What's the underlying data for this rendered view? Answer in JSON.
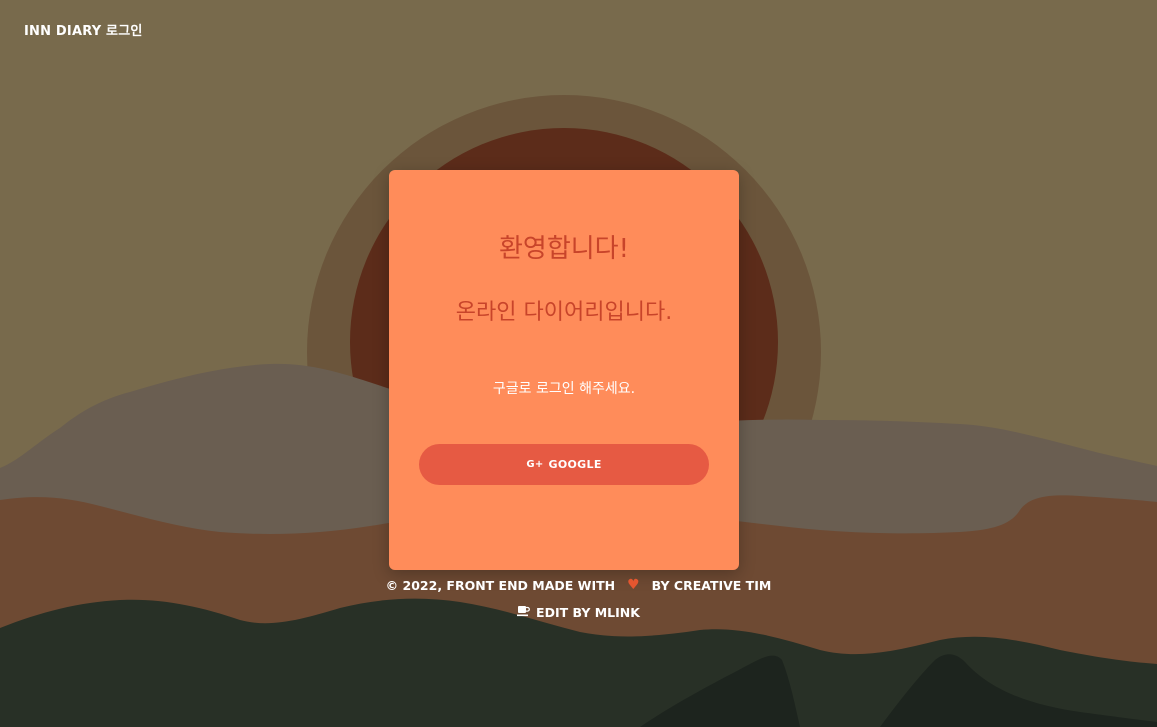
{
  "brand": {
    "title": "INN DIARY 로그인"
  },
  "card": {
    "title": "환영합니다!",
    "subtitle": "온라인 다이어리입니다.",
    "description": "구글로 로그인 해주세요.",
    "google_button": {
      "icon": "google-plus-icon",
      "icon_text": "G+",
      "label": "GOOGLE"
    }
  },
  "footer": {
    "copyright_prefix": "© 2022, FRONT END MADE WITH",
    "heart_icon": "heart-icon",
    "copyright_suffix": "BY CREATIVE TIM",
    "edit_icon": "coffee-icon",
    "edit_label": "EDIT BY MLINK"
  },
  "colors": {
    "sky": "#786a4c",
    "sun_ring": "#6b553b",
    "sun": "#5c2c1a",
    "card": "#ff8c5a",
    "card_text": "#c8442a",
    "button": "#e65a43",
    "heart": "#e4562f"
  }
}
